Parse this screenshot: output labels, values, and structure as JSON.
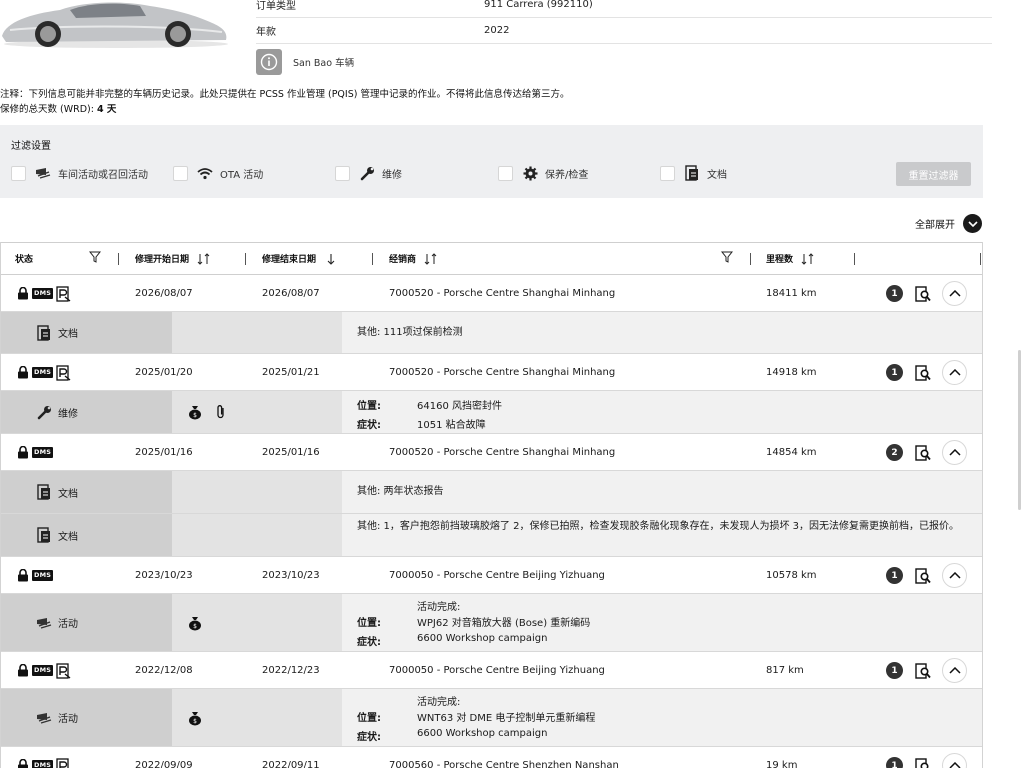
{
  "vehicle": {
    "order_type_label": "订单类型",
    "order_type_value": "911 Carrera (992110)",
    "model_year_label": "年款",
    "model_year_value": "2022",
    "sanbao_label": "San Bao 车辆"
  },
  "note": "注释：下列信息可能并非完整的车辆历史记录。此处只提供在 PCSS 作业管理 (PQIS) 管理中记录的作业。不得将此信息传达给第三方。",
  "wrd": {
    "label": "保修的总天数 (WRD): ",
    "value": "4 天"
  },
  "filter": {
    "title": "过滤设置",
    "options": [
      {
        "label": "车间活动或召回活动",
        "icon": "campaign-icon"
      },
      {
        "label": "OTA 活动",
        "icon": "wifi-icon"
      },
      {
        "label": "维修",
        "icon": "wrench-icon"
      },
      {
        "label": "保养/检查",
        "icon": "gear-icon"
      },
      {
        "label": "文档",
        "icon": "document-icon"
      }
    ],
    "reset_label": "重置过滤器"
  },
  "expand_all_label": "全部展开",
  "table": {
    "headers": {
      "status": "状态",
      "start": "修理开始日期",
      "end": "修理结束日期",
      "dealer": "经销商",
      "mileage": "里程数"
    },
    "rows": [
      {
        "start": "2026/08/07",
        "end": "2026/08/07",
        "dealer": "7000520 - Porsche Centre Shanghai Minhang",
        "mileage": "18411 km",
        "count": "1",
        "dms": "DMS",
        "sub": [
          {
            "type": "文档",
            "desc": "其他: 111项过保前检测"
          }
        ]
      },
      {
        "start": "2025/01/20",
        "end": "2025/01/21",
        "dealer": "7000520 - Porsche Centre Shanghai Minhang",
        "mileage": "14918 km",
        "count": "1",
        "dms": "DMS",
        "sub": [
          {
            "type": "维修",
            "loc_label": "位置:",
            "loc": "64160 风挡密封件",
            "sym_label": "症状:",
            "sym": "1051 粘合故障"
          }
        ]
      },
      {
        "start": "2025/01/16",
        "end": "2025/01/16",
        "dealer": "7000520 - Porsche Centre Shanghai Minhang",
        "mileage": "14854 km",
        "count": "2",
        "dms": "DMS",
        "sub": [
          {
            "type": "文档",
            "desc": "其他: 两年状态报告"
          },
          {
            "type": "文档",
            "desc": "其他: 1，客户抱怨前挡玻璃胶熔了 2，保修已拍照，检查发现胶条融化现象存在，未发现人为损坏 3，因无法修复需更换前档，已报价。"
          }
        ]
      },
      {
        "start": "2023/10/23",
        "end": "2023/10/23",
        "dealer": "7000050 - Porsche Centre Beijing Yizhuang",
        "mileage": "10578 km",
        "count": "1",
        "dms": "DMS",
        "sub": [
          {
            "type": "活动",
            "done": "活动完成:",
            "loc_label": "位置:",
            "loc": "WPJ62 对音箱放大器 (Bose) 重新编码",
            "sym_label": "症状:",
            "sym": "6600 Workshop campaign"
          }
        ]
      },
      {
        "start": "2022/12/08",
        "end": "2022/12/23",
        "dealer": "7000050 - Porsche Centre Beijing Yizhuang",
        "mileage": "817 km",
        "count": "1",
        "dms": "DMS",
        "sub": [
          {
            "type": "活动",
            "done": "活动完成:",
            "loc_label": "位置:",
            "loc": "WNT63 对 DME 电子控制单元重新编程",
            "sym_label": "症状:",
            "sym": "6600 Workshop campaign"
          }
        ]
      },
      {
        "start": "2022/09/09",
        "end": "2022/09/11",
        "dealer": "7000560 - Porsche Centre Shenzhen Nanshan",
        "mileage": "19 km",
        "count": "1",
        "dms": "DMS"
      }
    ]
  }
}
